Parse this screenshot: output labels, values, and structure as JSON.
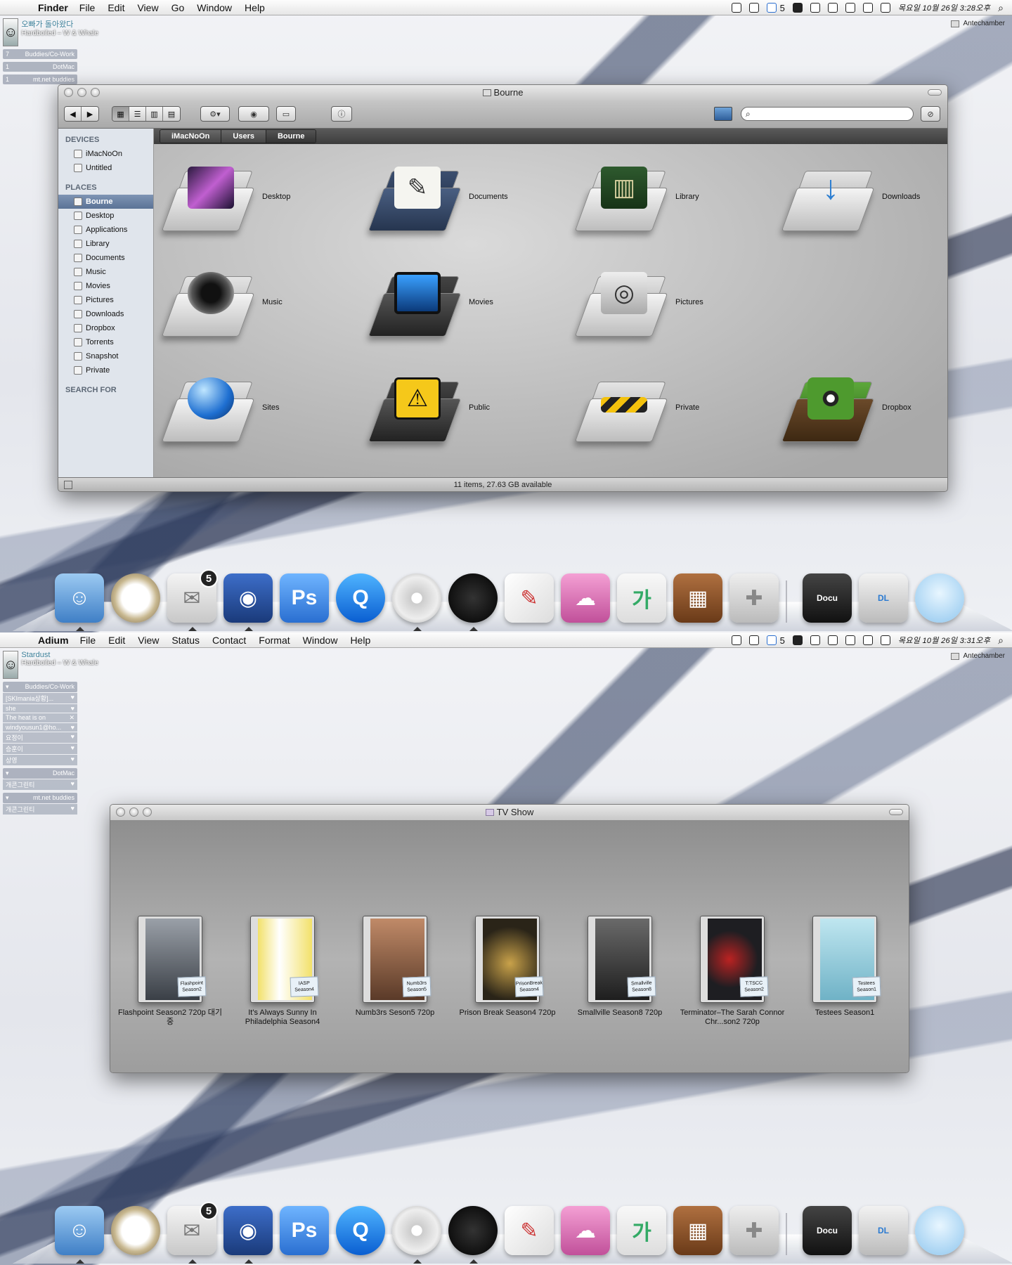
{
  "finder_screen": {
    "menubar": {
      "app": "Finder",
      "items": [
        "File",
        "Edit",
        "View",
        "Go",
        "Window",
        "Help"
      ],
      "status_count": "5",
      "clock": "목요일 10월 26일 3:28오후"
    },
    "adium": {
      "status": "오빠가 돌아왔다",
      "song": "Hardboiled – W & Whale",
      "groups": [
        {
          "count": "7",
          "name": "Buddies/Co-Work"
        },
        {
          "count": "1",
          "name": "DotMac"
        },
        {
          "count": "1",
          "name": "mt.net buddies"
        }
      ]
    },
    "antechamber": "Antechamber",
    "window": {
      "title": "Bourne",
      "sidebar": {
        "devices_header": "DEVICES",
        "devices": [
          "iMacNoOn",
          "Untitled"
        ],
        "places_header": "PLACES",
        "places": [
          "Bourne",
          "Desktop",
          "Applications",
          "Library",
          "Documents",
          "Music",
          "Movies",
          "Pictures",
          "Downloads",
          "Dropbox",
          "Torrents",
          "Snapshot",
          "Private"
        ],
        "search_header": "SEARCH FOR"
      },
      "path": [
        "iMacNoOn",
        "Users",
        "Bourne"
      ],
      "items": [
        "Desktop",
        "Documents",
        "Library",
        "Downloads",
        "Music",
        "Movies",
        "Pictures",
        "Sites",
        "Public",
        "Private",
        "Dropbox"
      ],
      "status": "11 items, 27.63 GB available"
    }
  },
  "adium_screen": {
    "menubar": {
      "app": "Adium",
      "items": [
        "File",
        "Edit",
        "View",
        "Status",
        "Contact",
        "Format",
        "Window",
        "Help"
      ],
      "status_count": "5",
      "clock": "목요일 10월 26일 3:31오후"
    },
    "adium": {
      "status": "Stardust",
      "song": "Hardboiled – W & Whale",
      "group1": "Buddies/Co-Work",
      "contacts1": [
        "[SKImania상황]...",
        "she",
        "The heat is on",
        "windyousun1@ho...",
        "요정이",
        "승훈이",
        "상영"
      ],
      "group2": "DotMac",
      "contacts2": [
        "개콘그린티"
      ],
      "group3": "mt.net buddies",
      "contacts3": [
        "개콘그린티"
      ]
    },
    "antechamber": "Antechamber",
    "window": {
      "title": "TV Show",
      "items": [
        {
          "label": "Flashpoint Season2 720p 대기중",
          "tag": "Flashpoint Season2",
          "color": "#5a5f66"
        },
        {
          "label": "It's Always Sunny In Philadelphia Season4",
          "tag": "IASP Season4",
          "color": "#e9d86a"
        },
        {
          "label": "Numb3rs Seson5 720p",
          "tag": "Numb3rs Season5",
          "color": "#8a5a40"
        },
        {
          "label": "Prison Break Season4 720p",
          "tag": "PrisonBreak Season4",
          "color": "#2a2418"
        },
        {
          "label": "Smallville Season8 720p",
          "tag": "Smallville Season8",
          "color": "#3a3a3a"
        },
        {
          "label": "Terminator–The Sarah Connor Chr...son2 720p",
          "tag": "T:TSCC Season2",
          "color": "#1e1e22"
        },
        {
          "label": "Testees Season1",
          "tag": "Testees Season1",
          "color": "#8fc8d8"
        }
      ]
    }
  },
  "dock": {
    "mail_badge": "5",
    "stack_docu": "Docu",
    "stack_dl": "DL"
  },
  "search": {
    "placeholder": ""
  }
}
